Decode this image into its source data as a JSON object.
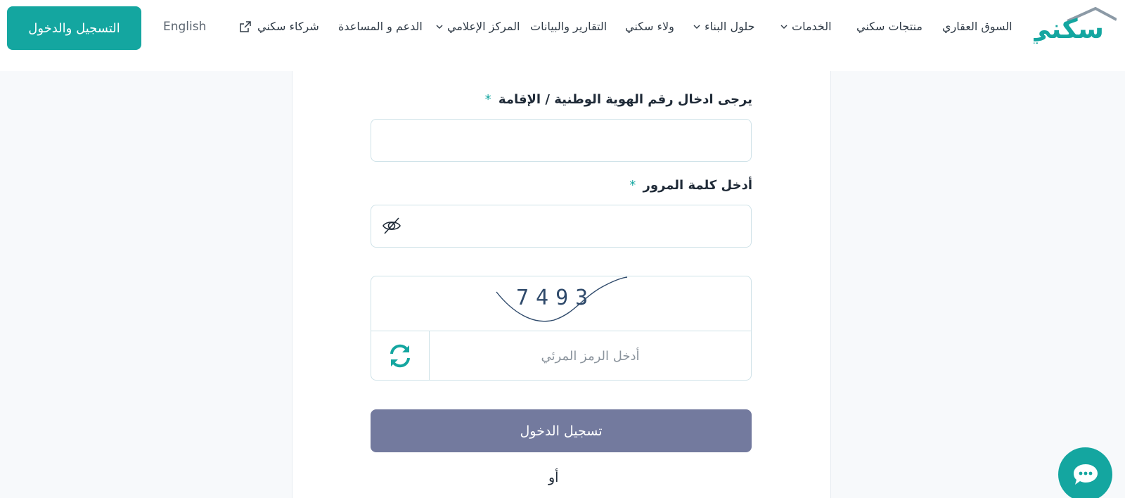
{
  "header": {
    "logo_text": "سكني",
    "nav": [
      {
        "label": "السوق العقاري",
        "dropdown": false
      },
      {
        "label": "منتجات سكني",
        "dropdown": false
      },
      {
        "label": "الخدمات",
        "dropdown": true
      },
      {
        "label": "حلول البناء",
        "dropdown": true
      },
      {
        "label": "ولاء سكني",
        "dropdown": false
      },
      {
        "label": "التقارير والبيانات",
        "dropdown": false
      },
      {
        "label": "المركز الإعلامي",
        "dropdown": true
      },
      {
        "label": "الدعم و المساعدة",
        "dropdown": false
      },
      {
        "label": "شركاء سكني",
        "external": true
      }
    ],
    "language_link": "English",
    "auth_button": "التسجيل والدخول"
  },
  "form": {
    "id_label": "يرجى ادخال رقم الهوية الوطنية / الإقامة",
    "id_value": "",
    "password_label": "أدخل كلمة المرور",
    "password_value": "",
    "required_mark": "*",
    "captcha_text": "7493",
    "captcha_placeholder": "أدخل الرمز المرئي",
    "login_button": "تسجيل الدخول",
    "or_text": "أو"
  },
  "colors": {
    "brand": "#14a6a0",
    "login_button": "#737a9e"
  },
  "icons": {
    "password_toggle": "eye-slash-icon",
    "captcha_refresh": "refresh-icon",
    "chat": "chat-bubble-icon",
    "external": "external-link-icon",
    "dropdown": "chevron-down-icon"
  }
}
